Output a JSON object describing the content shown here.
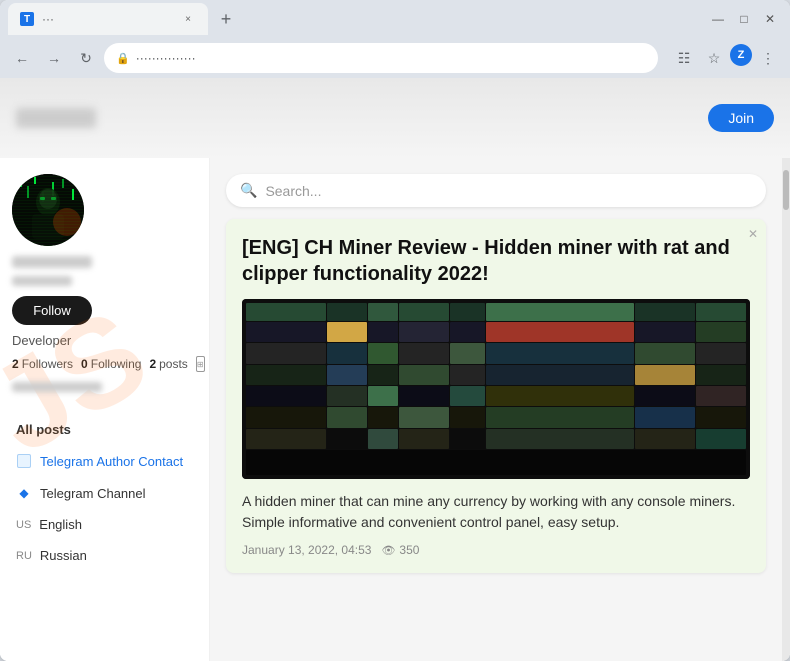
{
  "browser": {
    "tab": {
      "favicon": "T",
      "title_blur": "···",
      "close": "×"
    },
    "address": {
      "url": "···············",
      "lock_icon": "🔒"
    },
    "profile_letter": "Z",
    "window": {
      "minimize": "—",
      "maximize": "□",
      "close": "✕"
    }
  },
  "header": {
    "logo_blur": "",
    "join_label": "Join"
  },
  "sidebar": {
    "developer_label": "Developer",
    "follow_button": "Follow",
    "stats": {
      "followers_count": "2",
      "followers_label": "Followers",
      "following_count": "0",
      "following_label": "Following",
      "posts_count": "2",
      "posts_label": "posts"
    },
    "nav_items": [
      {
        "id": "all-posts",
        "label": "All posts",
        "icon_type": "none"
      },
      {
        "id": "telegram-author",
        "label": "Telegram Author Contact",
        "icon_type": "telegram"
      },
      {
        "id": "telegram-channel",
        "label": "Telegram Channel",
        "icon_type": "diamond"
      },
      {
        "id": "lang-english",
        "label": "English",
        "lang_prefix": "us",
        "icon_type": "lang"
      },
      {
        "id": "lang-russian",
        "label": "Russian",
        "lang_prefix": "ru",
        "icon_type": "lang"
      }
    ]
  },
  "search": {
    "placeholder": "Search..."
  },
  "post": {
    "title": "[ENG] CH Miner Review - Hidden miner with rat and clipper functionality 2022!",
    "description": "A hidden miner that can mine any currency by working with any console miners. Simple informative and convenient control panel, easy setup.",
    "date": "January 13, 2022, 04:53",
    "views": "350",
    "close_icon": "✕"
  }
}
